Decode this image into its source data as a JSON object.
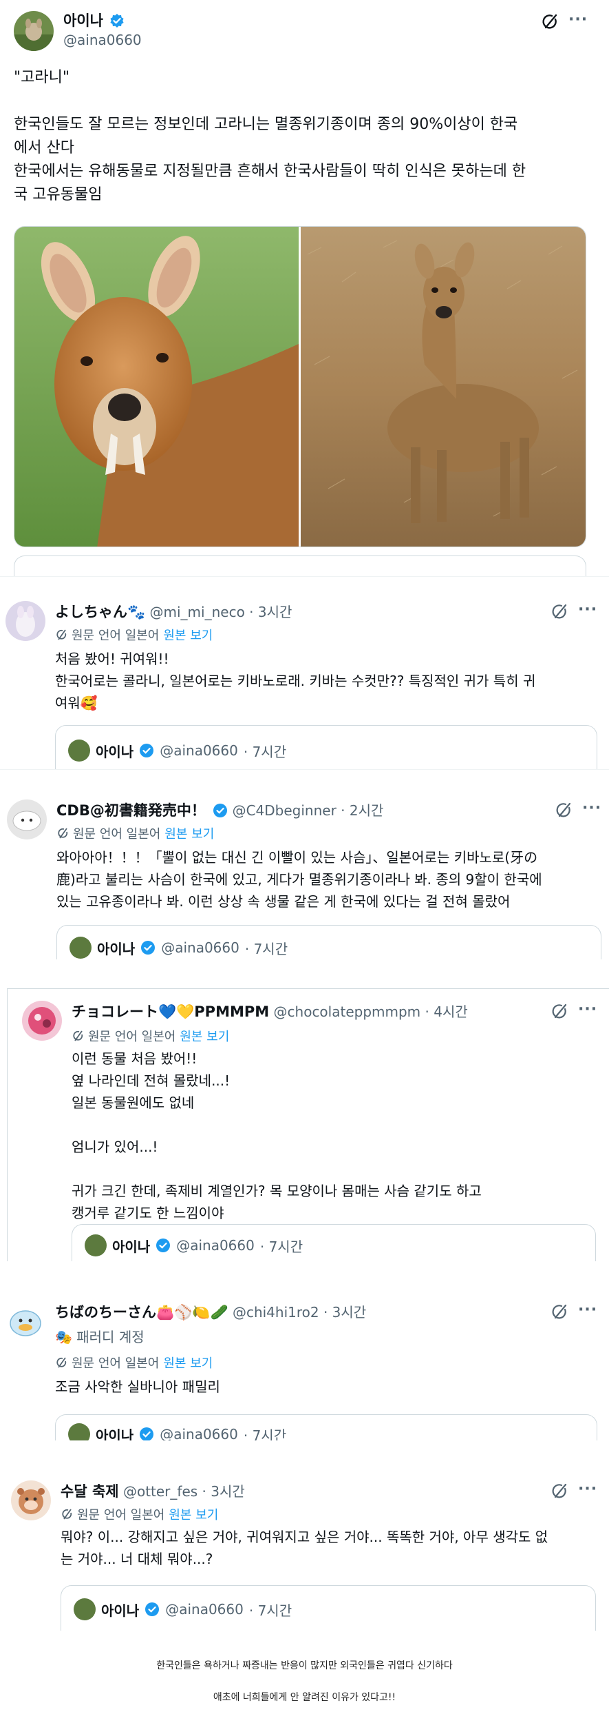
{
  "main_tweet": {
    "name": "아이나",
    "handle": "@aina0660",
    "title_line": "\"고라니\"",
    "para1": "한국인들도 잘 모르는 정보인데 고라니는 멸종위기종이며 종의 90%이상이 한국\n에서 산다",
    "para2": "한국에서는 유해동물로 지정될만큼 흔해서 한국사람들이 딱히 인식은 못하는데 한\n국 고유동물임"
  },
  "translate": {
    "label": "원문 언어 일본어",
    "link": "원본 보기"
  },
  "replies": [
    {
      "name": "よしちゃん🐾",
      "handle": "@mi_mi_neco",
      "time": "· 3시간",
      "text": "처음 봤어! 귀여워!!\n한국어로는 콜라니, 일본어로는 키바노로래. 키바는 수컷만?? 특징적인 귀가 특히 귀\n여워🥰",
      "quote_name": "아이나",
      "quote_handle": "@aina0660",
      "quote_time": "· 7시간"
    },
    {
      "name": "CDB@初書籍発売中！",
      "handle": "@C4Dbeginner",
      "time": "· 2시간",
      "text": "와아아아！！！「뿔이 없는 대신 긴 이빨이 있는 사슴」、일본어로는 키바노로(牙の\n鹿)라고 불리는 사슴이 한국에 있고, 게다가 멸종위기종이라나 봐. 종의 9할이 한국에\n있는 고유종이라나 봐. 이런 상상 속 생물 같은 게 한국에 있다는 걸 전혀 몰랐어",
      "quote_name": "아이나",
      "quote_handle": "@aina0660",
      "quote_time": "· 7시간"
    },
    {
      "name": "チョコレート💙💛PPMMPM",
      "handle": "@chocolateppmmpm",
      "time": "· 4시간",
      "text": "이런 동물 처음 봤어!!\n옆 나라인데 전혀 몰랐네...!\n일본 동물원에도 없네\n\n엄니가 있어...!\n\n귀가 크긴 한데, 족제비 계열인가? 목 모양이나 몸매는 사슴 같기도 하고\n캥거루 같기도 한 느낌이야",
      "quote_name": "아이나",
      "quote_handle": "@aina0660",
      "quote_time": "· 7시간"
    },
    {
      "name": "ちばのちーさん👛⚾🍋🥒",
      "handle": "@chi4hi1ro2",
      "time": "· 3시간",
      "badge": "🎭 패러디 계정",
      "text": "조금 사악한 실바니아 패밀리",
      "quote_name": "아이나",
      "quote_handle": "@aina0660",
      "quote_time": "· 7시간"
    },
    {
      "name": "수달 축제",
      "handle": "@otter_fes",
      "time": "· 3시간",
      "text": "뭐야? 이... 강해지고 싶은 거야, 귀여워지고 싶은 거야... 똑똑한 거야, 아무 생각도 없\n는 거야... 너 대체 뭐야...?",
      "quote_name": "아이나",
      "quote_handle": "@aina0660",
      "quote_time": "· 7시간"
    }
  ],
  "footer": {
    "line1": "한국인들은 욕하거나 짜증내는 반응이 많지만 외국인들은 귀엽다 신기하다",
    "line2": "애초에 너희들에게 안 알려진 이유가 있다고!!"
  },
  "colors": {
    "accent": "#1d9bf0",
    "secondary_text": "#536471",
    "border": "#cfd9de"
  }
}
